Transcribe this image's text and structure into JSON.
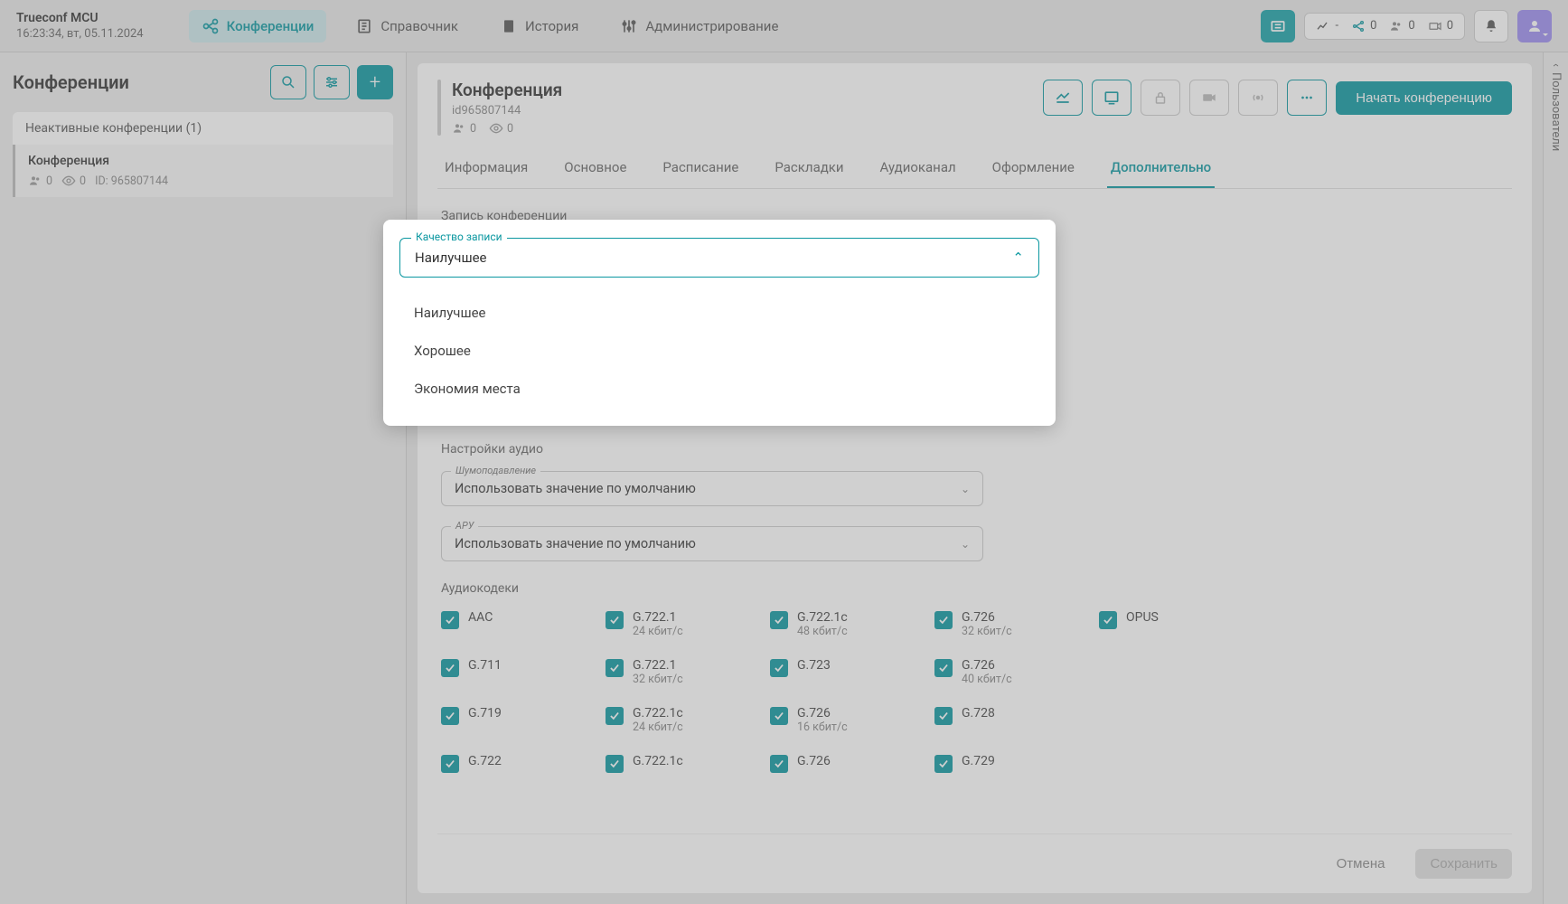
{
  "app": {
    "name": "Trueconf MCU",
    "datetime": "16:23:34, вт, 05.11.2024"
  },
  "nav": {
    "conferences": "Конференции",
    "directory": "Справочник",
    "history": "История",
    "admin": "Администрирование"
  },
  "topStatus": {
    "dash": "-",
    "c0": "0",
    "c1": "0",
    "c2": "0"
  },
  "sidebar": {
    "title": "Конференции",
    "group": "Неактивные конференции (1)",
    "item": {
      "title": "Конференция",
      "people": "0",
      "eye": "0",
      "id": "ID: 965807144"
    }
  },
  "conf": {
    "title": "Конференция",
    "id": "id965807144",
    "people": "0",
    "eye": "0",
    "startBtn": "Начать конференцию"
  },
  "tabs": {
    "info": "Информация",
    "main": "Основное",
    "schedule": "Расписание",
    "layouts": "Раскладки",
    "audio": "Аудиоканал",
    "design": "Оформление",
    "extra": "Дополнительно"
  },
  "sections": {
    "record": "Запись конференции",
    "audioSettings": "Настройки аудио",
    "codecs": "Аудиокодеки"
  },
  "fields": {
    "noise": {
      "label": "Шумоподавление",
      "value": "Использовать значение по умолчанию"
    },
    "aru": {
      "label": "АРУ",
      "value": "Использовать значение по умолчанию"
    }
  },
  "dropdown": {
    "label": "Качество записи",
    "value": "Наилучшее",
    "opt1": "Наилучшее",
    "opt2": "Хорошее",
    "opt3": "Экономия места"
  },
  "codecs": [
    {
      "name": "AAC",
      "rate": ""
    },
    {
      "name": "G.722.1",
      "rate": "24 кбит/с"
    },
    {
      "name": "G.722.1c",
      "rate": "48 кбит/с"
    },
    {
      "name": "G.726",
      "rate": "32 кбит/с"
    },
    {
      "name": "OPUS",
      "rate": ""
    },
    {
      "name": "G.711",
      "rate": ""
    },
    {
      "name": "G.722.1",
      "rate": "32 кбит/с"
    },
    {
      "name": "G.723",
      "rate": ""
    },
    {
      "name": "G.726",
      "rate": "40 кбит/с"
    },
    {
      "name": "",
      "rate": ""
    },
    {
      "name": "G.719",
      "rate": ""
    },
    {
      "name": "G.722.1c",
      "rate": "24 кбит/с"
    },
    {
      "name": "G.726",
      "rate": "16 кбит/с"
    },
    {
      "name": "G.728",
      "rate": ""
    },
    {
      "name": "",
      "rate": ""
    },
    {
      "name": "G.722",
      "rate": ""
    },
    {
      "name": "G.722.1c",
      "rate": ""
    },
    {
      "name": "G.726",
      "rate": ""
    },
    {
      "name": "G.729",
      "rate": ""
    },
    {
      "name": "",
      "rate": ""
    }
  ],
  "footer": {
    "cancel": "Отмена",
    "save": "Сохранить"
  },
  "rail": "Пользователи"
}
